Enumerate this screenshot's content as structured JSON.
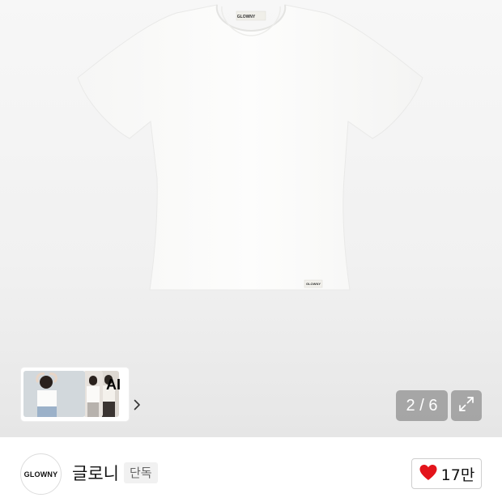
{
  "product": {
    "garment_label": "GLOWNY",
    "garment_color": "#fbfbfa"
  },
  "gallery": {
    "ai_label": "AI",
    "counter": "2 / 6",
    "current_index": 2,
    "total": 6
  },
  "brand": {
    "logo_text": "GLOWNY",
    "name": "글로니",
    "badge": "단독"
  },
  "like": {
    "count": "17만",
    "heart_color": "#e3141b"
  },
  "icons": {
    "chevron": "chevron-right-icon",
    "expand": "expand-icon",
    "heart": "heart-icon"
  }
}
